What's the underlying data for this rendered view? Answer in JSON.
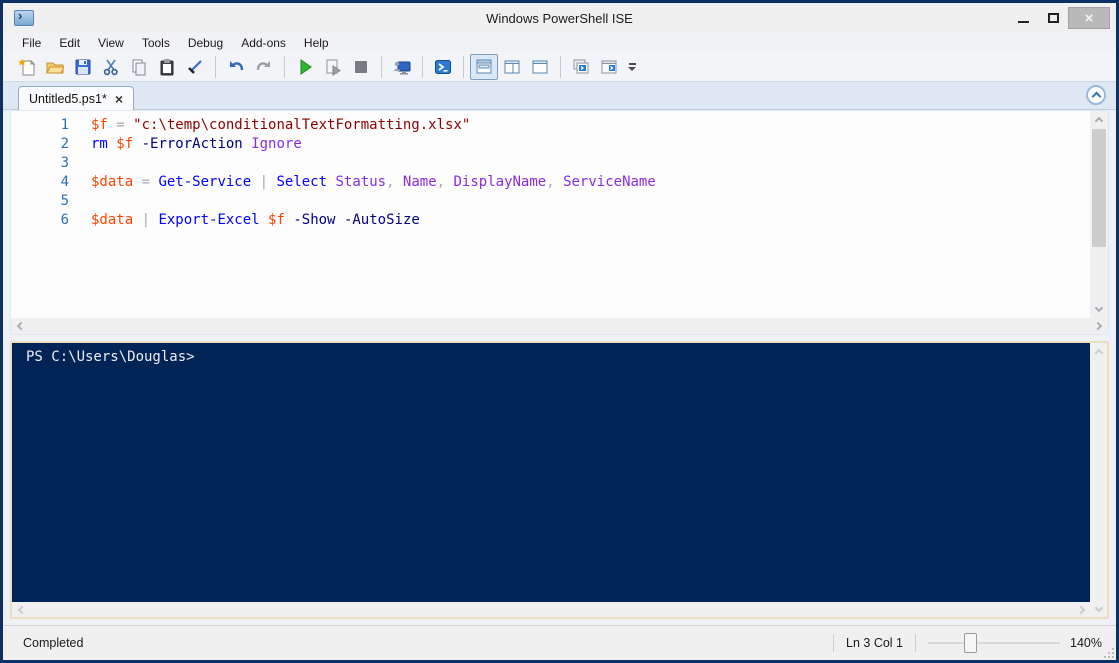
{
  "window": {
    "title": "Windows PowerShell ISE",
    "controls": {
      "minimize": "",
      "maximize": "",
      "close": "×"
    }
  },
  "menus": [
    "File",
    "Edit",
    "View",
    "Tools",
    "Debug",
    "Add-ons",
    "Help"
  ],
  "toolbar": {
    "icons": [
      "new-script-icon",
      "open-icon",
      "save-icon",
      "cut-icon",
      "copy-icon",
      "paste-icon",
      "clear-console-icon",
      "undo-icon",
      "redo-icon",
      "run-script-icon",
      "run-selection-icon",
      "stop-icon",
      "new-remote-tab-icon",
      "start-powershell-icon",
      "script-pane-top-icon",
      "script-pane-right-icon",
      "script-pane-max-icon",
      "powershell-tab-icon",
      "powershell-window-icon",
      "toolbar-overflow-icon"
    ],
    "selected": "script-pane-top-icon"
  },
  "tab": {
    "label": "Untitled5.ps1*",
    "close": "×"
  },
  "editor": {
    "lines": [
      {
        "num": "1",
        "tokens": [
          {
            "c": "variable",
            "t": "$f"
          },
          {
            "c": "operator",
            "t": " = "
          },
          {
            "c": "string",
            "t": "\"c:\\temp\\conditionalTextFormatting.xlsx\""
          }
        ]
      },
      {
        "num": "2",
        "tokens": [
          {
            "c": "command",
            "t": "rm"
          },
          {
            "c": "plain",
            "t": " "
          },
          {
            "c": "variable",
            "t": "$f"
          },
          {
            "c": "plain",
            "t": " "
          },
          {
            "c": "parameter",
            "t": "-ErrorAction"
          },
          {
            "c": "plain",
            "t": " "
          },
          {
            "c": "argument",
            "t": "Ignore"
          }
        ]
      },
      {
        "num": "3",
        "tokens": []
      },
      {
        "num": "4",
        "tokens": [
          {
            "c": "variable",
            "t": "$data"
          },
          {
            "c": "operator",
            "t": " = "
          },
          {
            "c": "command",
            "t": "Get-Service"
          },
          {
            "c": "operator",
            "t": " | "
          },
          {
            "c": "command",
            "t": "Select"
          },
          {
            "c": "plain",
            "t": " "
          },
          {
            "c": "argument",
            "t": "Status"
          },
          {
            "c": "operator",
            "t": ", "
          },
          {
            "c": "argument",
            "t": "Name"
          },
          {
            "c": "operator",
            "t": ", "
          },
          {
            "c": "argument",
            "t": "DisplayName"
          },
          {
            "c": "operator",
            "t": ", "
          },
          {
            "c": "argument",
            "t": "ServiceName"
          }
        ]
      },
      {
        "num": "5",
        "tokens": []
      },
      {
        "num": "6",
        "tokens": [
          {
            "c": "variable",
            "t": "$data"
          },
          {
            "c": "operator",
            "t": " | "
          },
          {
            "c": "command",
            "t": "Export-Excel"
          },
          {
            "c": "plain",
            "t": " "
          },
          {
            "c": "variable",
            "t": "$f"
          },
          {
            "c": "plain",
            "t": " "
          },
          {
            "c": "parameter",
            "t": "-Show"
          },
          {
            "c": "plain",
            "t": " "
          },
          {
            "c": "parameter",
            "t": "-AutoSize"
          }
        ]
      }
    ],
    "token_colors": {
      "variable": "#ff4500",
      "operator": "#a9a9a9",
      "string": "#8b0000",
      "command": "#0000ff",
      "parameter": "#000080",
      "argument": "#8a2be2",
      "line_number": "#2b6fb5"
    }
  },
  "console": {
    "prompt": "PS C:\\Users\\Douglas>",
    "background": "#012456",
    "foreground": "#eeedf0"
  },
  "statusbar": {
    "status": "Completed",
    "position": "Ln 3 Col 1",
    "zoom": "140%"
  }
}
